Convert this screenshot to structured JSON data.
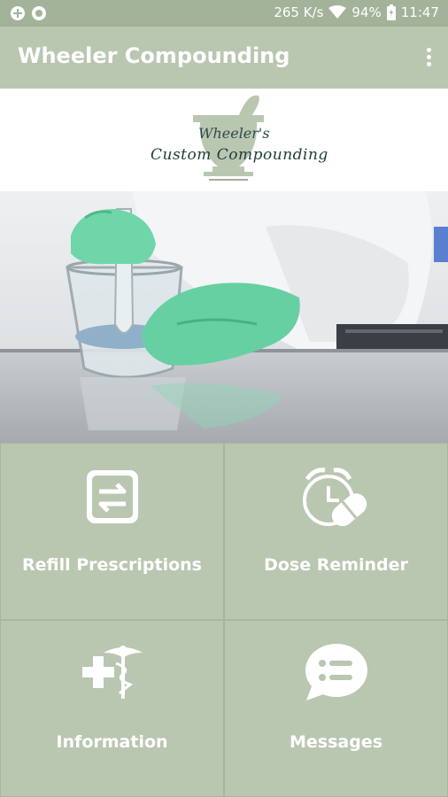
{
  "status_bar": {
    "network_speed": "265 K/s",
    "battery": "94%",
    "time": "11:47",
    "icons": [
      "app-notification-icon",
      "circle-notification-icon",
      "wifi-icon",
      "battery-icon"
    ]
  },
  "app_bar": {
    "title": "Wheeler Compounding",
    "menu_icon": "overflow-menu-icon"
  },
  "logo": {
    "script_text": "Wheeler's",
    "main_text": "Custom Compounding",
    "icon": "mortar-pestle-logo"
  },
  "hero": {
    "image": "lab-mortar-gloves-photo"
  },
  "tiles": [
    {
      "label": "Refill Prescriptions",
      "icon": "refill-icon"
    },
    {
      "label": "Dose Reminder",
      "icon": "alarm-pill-icon"
    },
    {
      "label": "Information",
      "icon": "medical-info-icon"
    },
    {
      "label": "Messages",
      "icon": "chat-bubble-icon"
    }
  ],
  "colors": {
    "primary": "#b9c7b1",
    "status_bar": "#a2b39a",
    "tile_border": "#a7b69f",
    "text_on_primary": "#ffffff"
  }
}
